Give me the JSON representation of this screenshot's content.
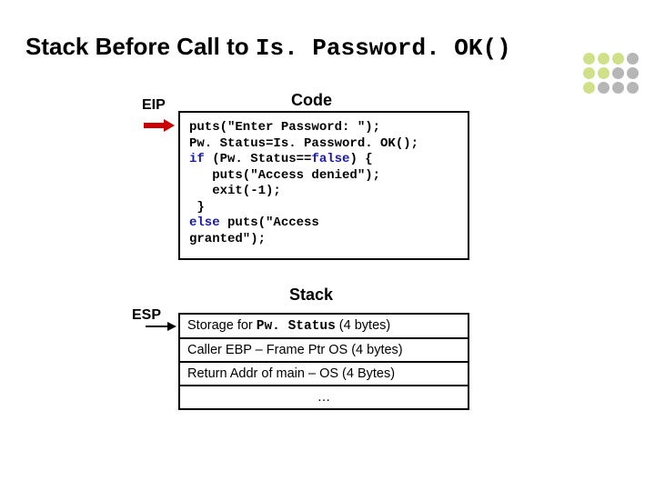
{
  "title": {
    "prefix": "Stack Before Call to ",
    "mono": "Is. Password. OK()"
  },
  "deco_colors": [
    "#cfe089",
    "#cfe089",
    "#cfe089",
    "#b6b6b6",
    "#cfe089",
    "#cfe089",
    "#b6b6b6",
    "#b6b6b6",
    "#cfe089",
    "#b6b6b6",
    "#b6b6b6",
    "#b6b6b6"
  ],
  "labels": {
    "eip": "EIP",
    "esp": "ESP",
    "code_heading": "Code",
    "stack_heading": "Stack"
  },
  "code": {
    "l1": "puts(\"Enter Password: \");",
    "l2": "Pw. Status=Is. Password. OK();",
    "l3a": "if",
    "l3b": " (Pw. Status==",
    "l3c": "false",
    "l3d": ") {",
    "l4": "   puts(\"Access denied\");",
    "l5": "   exit(-1);",
    "l6": " }",
    "l7a": "else",
    "l7b": " puts(\"Access",
    "l8": "granted\");"
  },
  "stack_rows": [
    {
      "prefix": "Storage for ",
      "mono": "Pw. Status",
      "suffix": " (4 bytes)"
    },
    {
      "text": "Caller EBP – Frame Ptr OS (4 bytes)"
    },
    {
      "text": "Return Addr of main – OS (4 Bytes)"
    },
    {
      "text": "…"
    }
  ]
}
